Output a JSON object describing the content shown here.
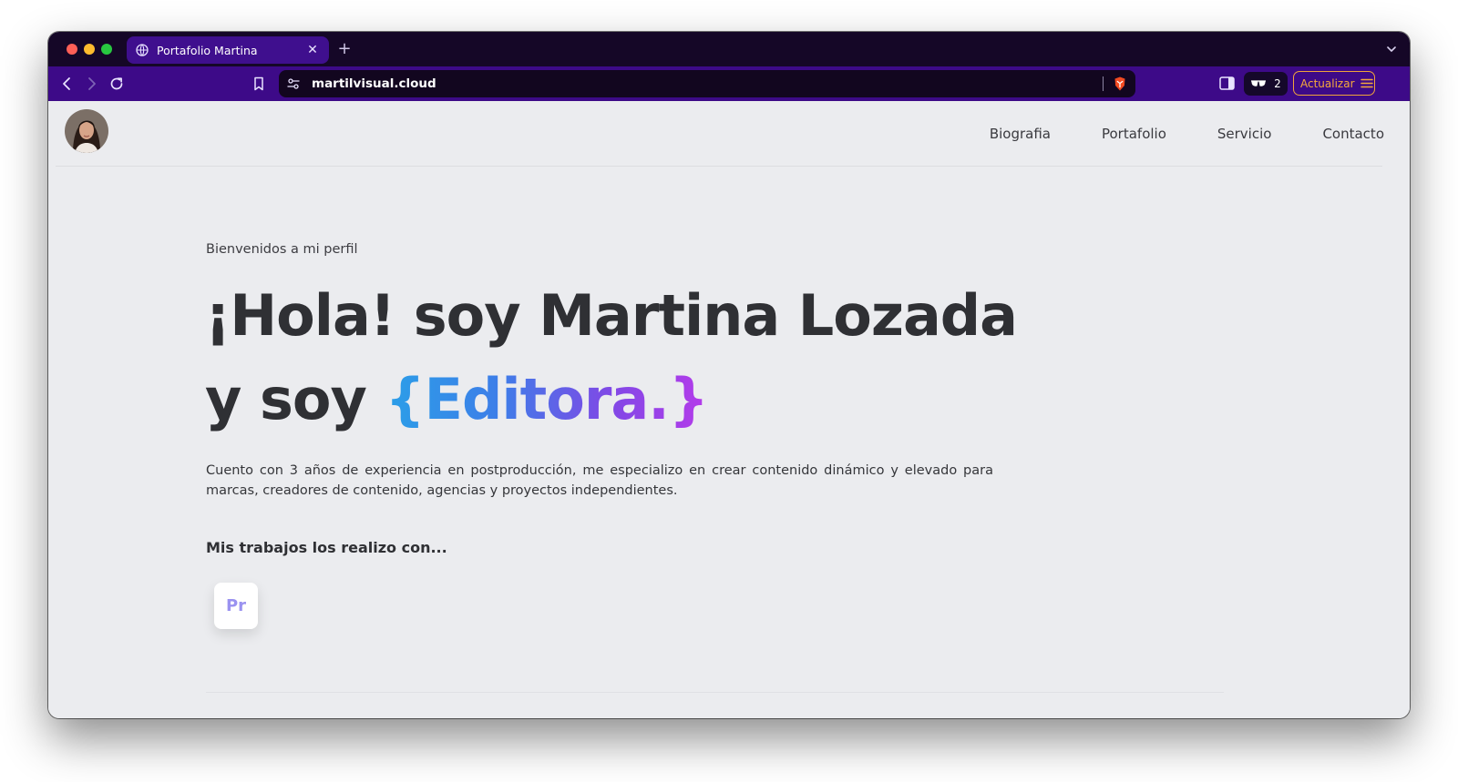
{
  "browser": {
    "tab": {
      "title": "Portafolio Martina",
      "close_glyph": "✕",
      "icon": "globe-icon"
    },
    "new_tab_glyph": "+",
    "url": "martilvisual.cloud",
    "extension_count": "2",
    "update_label": "Actualizar",
    "accent": "#3d0a88",
    "tab_active_color": "#3f0f8e",
    "update_color": "#f5a93c"
  },
  "site": {
    "nav": [
      "Biografia",
      "Portafolio",
      "Servicio",
      "Contacto"
    ],
    "hero": {
      "greeting": "Bienvenidos a mi perfil",
      "line1": "¡Hola! soy Martina Lozada",
      "line2_prefix": "y soy ",
      "line2_highlight": "{Editora.}",
      "description": "Cuento con 3 años de experiencia en postproducción, me especializo en crear contenido dinámico y elevado para marcas, creadores de contenido, agencias y proyectos independientes."
    },
    "tools": {
      "title": "Mis trabajos los realizo con...",
      "items": [
        {
          "label": "Pr",
          "icon": "premiere-pro-icon"
        }
      ]
    },
    "gradient_colors": [
      "#2b9fe8",
      "#8148e6",
      "#b53bea"
    ]
  }
}
